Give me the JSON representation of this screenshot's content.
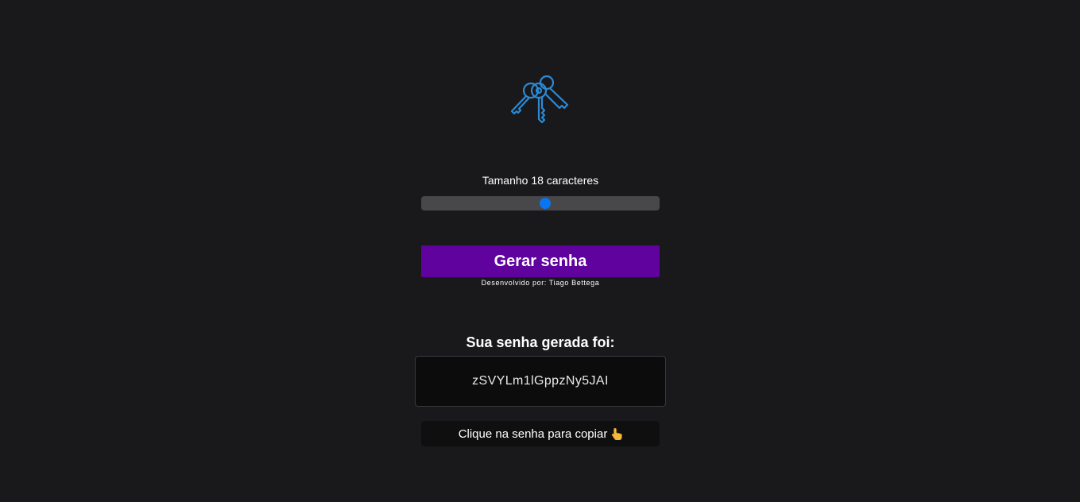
{
  "logo": {
    "icon": "keys-icon",
    "color": "#2a8ad6"
  },
  "generator": {
    "size_label": "Tamanho 18 caracteres",
    "slider": {
      "value": 18,
      "min": 4,
      "max": 32,
      "fraction": 0.52
    },
    "button_label": "Gerar senha",
    "credit": "Desenvolvido por: Tiago Bettega"
  },
  "result": {
    "title": "Sua senha gerada foi:",
    "password": "zSVYLm1lGppzNy5JAI",
    "copy_hint": "Clique na senha para copiar",
    "hint_icon": "pointing-hand-icon"
  },
  "colors": {
    "background": "#19191c",
    "button": "#5f029e",
    "slider_thumb": "#0a75f0",
    "slider_track": "#48484a"
  }
}
